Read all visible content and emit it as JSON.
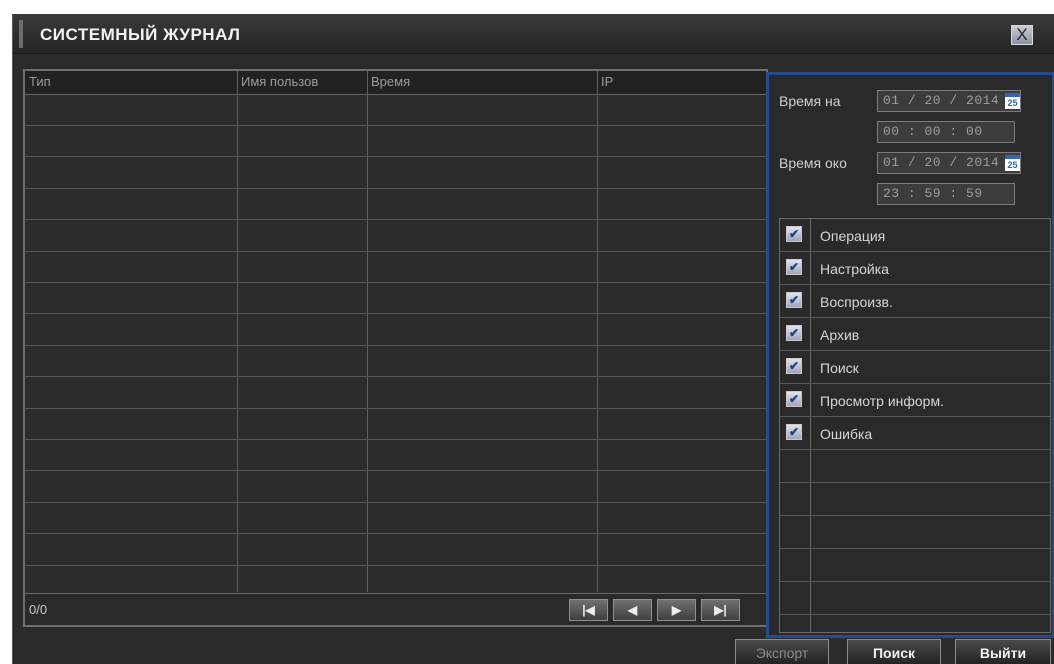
{
  "window": {
    "title": "СИСТЕМНЫЙ ЖУРНАЛ",
    "close_glyph": "X"
  },
  "log_table": {
    "columns": [
      "Тип",
      "Имя пользов",
      "Время",
      "IP"
    ],
    "rows": [],
    "page_counter": "0/0"
  },
  "pagination": {
    "first_icon": "skip-first-icon",
    "prev_icon": "prev-icon",
    "next_icon": "next-icon",
    "last_icon": "skip-last-icon"
  },
  "filters": {
    "start_label": "Время на",
    "start_date": "01 / 20 / 2014",
    "start_time": "00 : 00 : 00",
    "end_label": "Время око",
    "end_date": "01 / 20 / 2014",
    "end_time": "23 : 59 : 59",
    "calendar_day": "25",
    "categories": [
      {
        "label": "Операция",
        "checked": true
      },
      {
        "label": "Настройка",
        "checked": true
      },
      {
        "label": "Воспроизв.",
        "checked": true
      },
      {
        "label": "Архив",
        "checked": true
      },
      {
        "label": "Поиск",
        "checked": true
      },
      {
        "label": "Просмотр информ.",
        "checked": true
      },
      {
        "label": "Ошибка",
        "checked": true
      }
    ]
  },
  "buttons": {
    "export": "Экспорт",
    "search": "Поиск",
    "exit": "Выйти"
  },
  "colors": {
    "accent_border": "#244c8f",
    "disabled_text": "#8a8a8a"
  }
}
